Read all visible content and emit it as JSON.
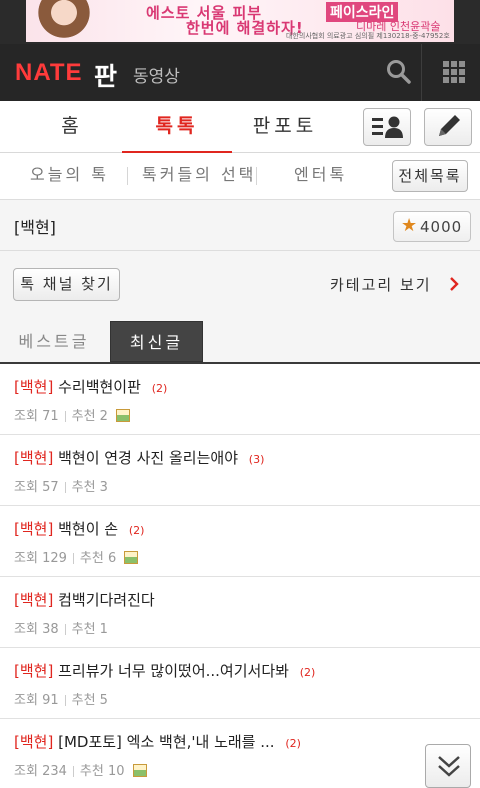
{
  "ad": {
    "line1": "에스토 서울 피부",
    "line2": "한번에 해결하자!",
    "right1": "페이스라인",
    "right2": "디마레 인천윤곽술",
    "small": "대한의사협회 의료광고 심의필 제130218-중-47952호"
  },
  "header": {
    "logo": "NATE",
    "logo_suffix": "판",
    "subtitle": "동영상",
    "search_icon": "search-icon",
    "menu_icon": "grid-menu-icon"
  },
  "tabs": {
    "home": "홈",
    "talk": "톡톡",
    "photo": "판포토"
  },
  "subtabs": {
    "today": "오늘의 톡",
    "choice": "톡커들의 선택",
    "enter": "엔터톡",
    "all": "전체목록"
  },
  "channel": {
    "name": "[백현]",
    "fav_count": "4000"
  },
  "finder": {
    "find_label": "톡 채널 찾기",
    "category_label": "카테고리 보기"
  },
  "list_tabs": {
    "best": "베스트글",
    "new": "최신글"
  },
  "posts": [
    {
      "tag": "[백현]",
      "title": "수리백현이판",
      "comments": "(2)",
      "views_label": "조회",
      "views": "71",
      "rec_label": "추천",
      "rec": "2",
      "has_image": true
    },
    {
      "tag": "[백현]",
      "title": "백현이 연경 사진 올리는애야",
      "comments": "(3)",
      "views_label": "조회",
      "views": "57",
      "rec_label": "추천",
      "rec": "3",
      "has_image": false
    },
    {
      "tag": "[백현]",
      "title": "백현이 손",
      "comments": "(2)",
      "views_label": "조회",
      "views": "129",
      "rec_label": "추천",
      "rec": "6",
      "has_image": true
    },
    {
      "tag": "[백현]",
      "title": "컴백기다려진다",
      "comments": "",
      "views_label": "조회",
      "views": "38",
      "rec_label": "추천",
      "rec": "1",
      "has_image": false
    },
    {
      "tag": "[백현]",
      "title": "프리뷰가 너무 많이떴어...여기서다봐",
      "comments": "(2)",
      "views_label": "조회",
      "views": "91",
      "rec_label": "추천",
      "rec": "5",
      "has_image": false
    },
    {
      "tag": "[백현]",
      "title": "[MD포토] 엑소 백현,'내 노래를 ...",
      "comments": "(2)",
      "views_label": "조회",
      "views": "234",
      "rec_label": "추천",
      "rec": "10",
      "has_image": true
    }
  ],
  "colors": {
    "accent": "#e0261f",
    "topbar": "#262626",
    "logo": "#ff3b3b"
  }
}
